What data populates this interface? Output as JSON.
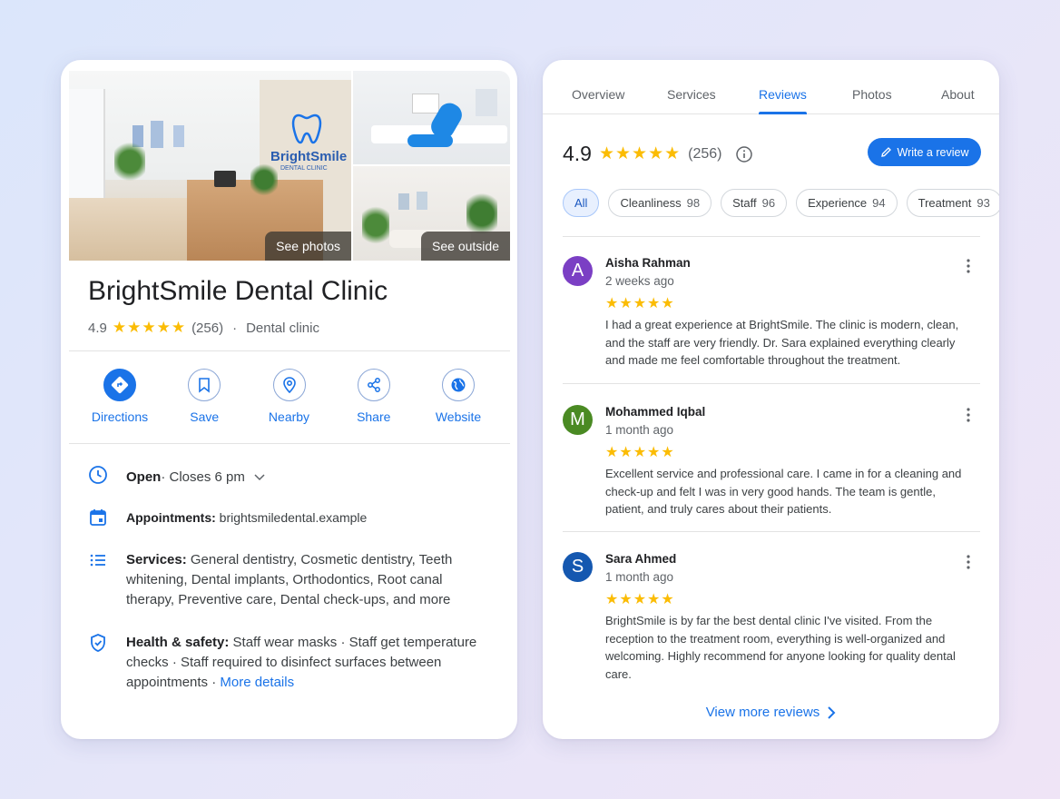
{
  "business": {
    "name": "BrightSmile Dental Clinic",
    "rating": "4.9",
    "stars": "★★★★★",
    "review_count": "(256)",
    "separator": "·",
    "category": "Dental clinic",
    "logo_text": "BrightSmile",
    "logo_subtext": "DENTAL CLINIC"
  },
  "photos": {
    "see_photos": "See photos",
    "see_outside": "See outside"
  },
  "actions": [
    {
      "label": "Directions",
      "icon": "directions-icon"
    },
    {
      "label": "Save",
      "icon": "bookmark-icon"
    },
    {
      "label": "Nearby",
      "icon": "location-pin-icon"
    },
    {
      "label": "Share",
      "icon": "share-icon"
    },
    {
      "label": "Website",
      "icon": "globe-icon"
    }
  ],
  "info": {
    "hours_status": "Open",
    "hours_detail": " · Closes 6 pm",
    "appointments_label": "Appointments:",
    "appointments_value": " brightsmiledental.example",
    "services_label": "Services:",
    "services_value": " General dentistry, Cosmetic dentistry, Teeth whitening, Dental implants, Orthodontics, Root canal therapy, Preventive care, Dental check-ups, and more",
    "health_label": "Health & safety:",
    "health_value": " Staff wear masks · Staff get temperature checks · Staff required to disinfect surfaces between appointments · ",
    "health_link": "More details"
  },
  "tabs": [
    "Overview",
    "Services",
    "Reviews",
    "Photos",
    "About"
  ],
  "active_tab": "Reviews",
  "reviews_summary": {
    "rating": "4.9",
    "stars": "★★★★★",
    "count": "(256)",
    "write_label": "Write a review"
  },
  "chips": [
    {
      "label": "All",
      "count": ""
    },
    {
      "label": "Cleanliness",
      "count": "98"
    },
    {
      "label": "Staff",
      "count": "96"
    },
    {
      "label": "Experience",
      "count": "94"
    },
    {
      "label": "Treatment",
      "count": "93"
    }
  ],
  "reviews": [
    {
      "initial": "A",
      "color": "#7b3fc4",
      "name": "Aisha Rahman",
      "time": "2 weeks ago",
      "stars": "★★★★★",
      "text": "I had a great experience at BrightSmile. The clinic is modern, clean, and the staff are very friendly. Dr. Sara explained everything clearly and made me feel comfortable throughout the treatment."
    },
    {
      "initial": "M",
      "color": "#4a8a23",
      "name": "Mohammed Iqbal",
      "time": "1 month ago",
      "stars": "★★★★★",
      "text": "Excellent service and professional care. I came in for a cleaning and check-up and felt I was in very good hands. The team is gentle, patient, and truly cares about their patients."
    },
    {
      "initial": "S",
      "color": "#1558b0",
      "name": "Sara Ahmed",
      "time": "1 month ago",
      "stars": "★★★★★",
      "text": "BrightSmile is by far the best dental clinic I've visited. From the reception to the treatment room, everything is well-organized and welcoming. Highly recommend for anyone looking for quality dental care."
    }
  ],
  "view_more": "View more reviews",
  "colors": {
    "accent": "#1a73e8",
    "star": "#fbbc04"
  }
}
